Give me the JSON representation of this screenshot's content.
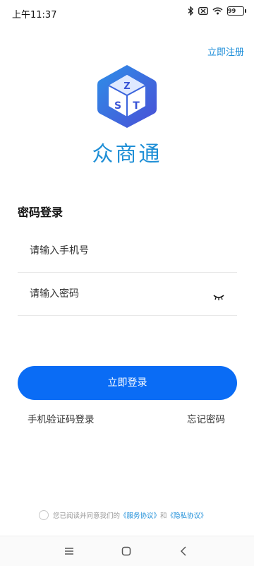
{
  "status_bar": {
    "time": "上午11:37",
    "battery": "99",
    "icons": [
      "bluetooth-icon",
      "silent-icon",
      "wifi-icon",
      "battery-icon"
    ]
  },
  "header": {
    "register_link": "立即注册"
  },
  "brand": {
    "name": "众商通",
    "logo_letters": [
      "Z",
      "S",
      "T"
    ],
    "colors": {
      "primary": "#1f8fd6",
      "button": "#0a6cf5"
    }
  },
  "login": {
    "title": "密码登录",
    "phone_placeholder": "请输入手机号",
    "password_placeholder": "请输入密码",
    "submit_label": "立即登录",
    "sms_login_label": "手机验证码登录",
    "forgot_password_label": "忘记密码"
  },
  "agreement": {
    "prefix": "您已阅读并同意我们的",
    "service_link": "《服务协议》",
    "joiner": "和",
    "privacy_link": "《隐私协议》"
  },
  "nav_bar": {
    "buttons": [
      "menu-icon",
      "home-icon",
      "back-icon"
    ]
  }
}
